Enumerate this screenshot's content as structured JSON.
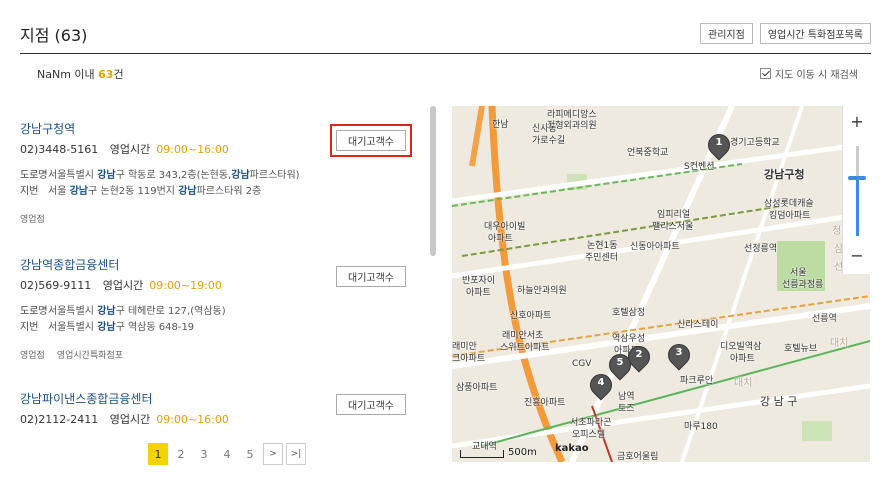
{
  "header": {
    "title": "지점 (63)",
    "buttons": [
      "관리지점",
      "영업시간 특화점포목록"
    ]
  },
  "results": {
    "prefix": "NaNm 이내 ",
    "count": "63",
    "suffix": "건",
    "research_label": "지도 이동 시 재검색",
    "research_checked": true
  },
  "branches": [
    {
      "name_hl": "강남",
      "name_rest": "구청역",
      "phone": "02)3448-5161",
      "hours_label": "영업시간",
      "hours": "09:00~16:00",
      "road_label": "도로명",
      "road_a": "서울특별시 ",
      "road_hl": "강남",
      "road_b": "구 학동로 343,2층(논현동,",
      "road_hl2": "강남",
      "road_c": "파르스타워)",
      "lot_label": "지번",
      "lot_a": "서울 ",
      "lot_hl": "강남",
      "lot_b": "구 논현2동 119번지 ",
      "lot_hl2": "강남",
      "lot_c": "파르스타워 2층",
      "tags": [
        "영업점"
      ],
      "wait_label": "대기고객수",
      "highlighted": true
    },
    {
      "name_hl": "강남",
      "name_rest": "역종합금융센터",
      "phone": "02)569-9111",
      "hours_label": "영업시간",
      "hours": "09:00~19:00",
      "road_label": "도로명",
      "road_a": "서울특별시 ",
      "road_hl": "강남",
      "road_b": "구 테헤란로 127,(역삼동)",
      "road_hl2": "",
      "road_c": "",
      "lot_label": "지번",
      "lot_a": "서울특별시 ",
      "lot_hl": "강남",
      "lot_b": "구 역삼동 648-19",
      "lot_hl2": "",
      "lot_c": "",
      "tags": [
        "영업점",
        "영업시간특화점포"
      ],
      "wait_label": "대기고객수",
      "highlighted": false
    },
    {
      "name_hl": "강남",
      "name_rest": "파이낸스종합금융센터",
      "phone": "02)2112-2411",
      "hours_label": "영업시간",
      "hours": "09:00~16:00",
      "wait_label": "대기고객수",
      "highlighted": false
    }
  ],
  "pagination": {
    "pages": [
      "1",
      "2",
      "3",
      "4",
      "5"
    ],
    "active": "1",
    "next": ">",
    "last": ">|"
  },
  "map": {
    "labels": {
      "l1": "라피메디앙스",
      "l2": "정형외과의원",
      "l3": "신사동",
      "l4": "가로수길",
      "l5": "한남",
      "l6": "언북중학교",
      "l7": "S컨벤션",
      "l8": "경기고등학교",
      "l9": "강남구청",
      "l10": "삼성롯데캐슬",
      "l11": "킹덤아파트",
      "l12": "대우아이빌",
      "l13": "아파트",
      "l14": "논현1동",
      "l15": "주민센터",
      "l16": "임피리얼",
      "l17": "팰리스서울",
      "l18": "신동아아파트",
      "l19": "선정릉역",
      "l20": "반포자이",
      "l21": "아파트",
      "l22": "하늘안과의원",
      "l23": "서울",
      "l24": "선릉과정릉",
      "l25": "호텔삼정",
      "l26": "산호아파트",
      "l27": "신라스테이",
      "l28": "선릉역",
      "l29": "래미안서초",
      "l30": "스위트아파트",
      "l31": "래미안",
      "l32": "크아파트",
      "l33": "역삼우성",
      "l34": "아파트",
      "l35": "CGV",
      "l36": "디오빌역삼",
      "l37": "아파트",
      "l38": "호텔뉴브",
      "l39": "파크루안",
      "l40": "삼풍아파트",
      "l41": "진흥아파트",
      "l42": "남역",
      "l43": "토즈",
      "l44": "강 남 구",
      "l45": "서초파라곤",
      "l46": "오피스텔",
      "l47": "마루180",
      "l48": "교대역",
      "l49": "금호어울림",
      "l50": "청담",
      "l51": "대치",
      "l52": "삼",
      "l53": "선",
      "l54": "대치"
    },
    "markers": [
      "1",
      "2",
      "3",
      "4",
      "5"
    ],
    "scale": "500m",
    "brand": "kakao",
    "zoom_in": "+",
    "zoom_out": "−",
    "zoom_level_fraction": 0.6
  }
}
